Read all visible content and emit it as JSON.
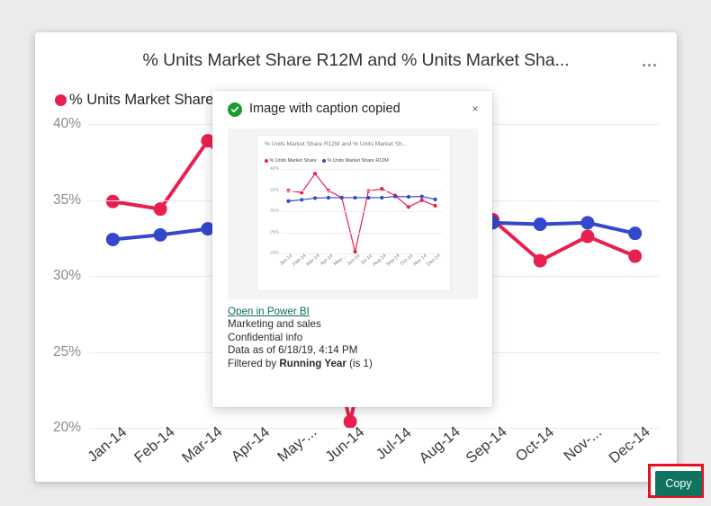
{
  "card": {
    "title": "% Units Market Share R12M and % Units Market Sha...",
    "more_menu_label": "More options"
  },
  "dialog": {
    "title": "Image with caption copied",
    "success_icon": "check-circle-icon",
    "close_label": "×",
    "link_text": "Open in Power BI",
    "caption_lines": [
      "Marketing and sales",
      "Confidential info",
      "Data as of 6/18/19, 4:14 PM"
    ],
    "filter_prefix": "Filtered by ",
    "filter_name": "Running Year",
    "filter_suffix": " (is 1)",
    "copy_label": "Copy",
    "copy_button_color": "#107360",
    "highlight_color": "#e81123",
    "link_color": "#0f6b5c",
    "success_color": "#1c9c2e"
  },
  "chart_data": [
    {
      "id": "main",
      "type": "line",
      "title": "% Units Market Share R12M and % Units Market Sha...",
      "xlabel": "",
      "ylabel": "",
      "ylim": [
        20,
        40
      ],
      "yticks": [
        "20%",
        "25%",
        "30%",
        "35%",
        "40%"
      ],
      "ytick_values": [
        20,
        25,
        30,
        35,
        40
      ],
      "grid": true,
      "legend_position": "top-left",
      "categories": [
        "Jan-14",
        "Feb-14",
        "Mar-14",
        "Apr-14",
        "May-...",
        "Jun-14",
        "Jul-14",
        "Aug-14",
        "Sep-14",
        "Oct-14",
        "Nov-...",
        "Dec-14"
      ],
      "series": [
        {
          "name": "% Units Market Share",
          "color": "#e8204f",
          "values": [
            34.9,
            34.4,
            38.9,
            34.9,
            33.2,
            20.4,
            34.8,
            35.3,
            33.7,
            31.0,
            32.6,
            31.3
          ]
        },
        {
          "name": "% Units Market Share R12M",
          "color": "#3348cc",
          "values": [
            32.4,
            32.7,
            33.1,
            33.2,
            33.2,
            33.2,
            33.2,
            33.2,
            33.5,
            33.4,
            33.5,
            32.8
          ]
        }
      ]
    },
    {
      "id": "preview",
      "type": "line",
      "title": "% Units Market Share R12M and % Units Market Sh...",
      "xlabel": "",
      "ylabel": "",
      "ylim": [
        20,
        40
      ],
      "yticks": [
        "20%",
        "25%",
        "30%",
        "35%",
        "40%"
      ],
      "ytick_values": [
        20,
        25,
        30,
        35,
        40
      ],
      "grid": true,
      "legend_position": "top-left",
      "categories": [
        "Jan-14",
        "Feb-14",
        "Mar-14",
        "Apr-14",
        "May-...",
        "Jun-14",
        "Jul-14",
        "Aug-14",
        "Sep-14",
        "Oct-14",
        "Nov-14",
        "Dec-14"
      ],
      "series": [
        {
          "name": "% Units Market Share",
          "color": "#e8204f",
          "values": [
            34.9,
            34.4,
            38.9,
            34.9,
            33.2,
            20.4,
            34.8,
            35.3,
            33.7,
            31.0,
            32.6,
            31.3
          ]
        },
        {
          "name": "% Units Market Share R12M",
          "color": "#3348cc",
          "values": [
            32.4,
            32.7,
            33.1,
            33.2,
            33.2,
            33.2,
            33.2,
            33.2,
            33.5,
            33.4,
            33.5,
            32.8
          ]
        }
      ]
    }
  ]
}
